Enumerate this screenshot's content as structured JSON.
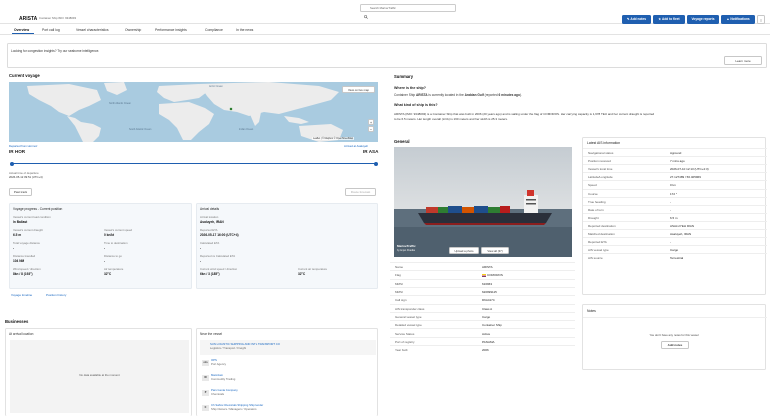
{
  "header": {
    "vessel_name": "ARISTA",
    "vessel_subtitle": "Container Ship IMO: 9348093",
    "search_placeholder": "Search MarineTraffic",
    "buttons": [
      "Add notes",
      "Add to fleet",
      "Voyage reports",
      "Notifications"
    ]
  },
  "tabs": [
    {
      "label": "Overview",
      "active": true
    },
    {
      "label": "Port call log"
    },
    {
      "label": "Vessel characteristics"
    },
    {
      "label": "Ownership"
    },
    {
      "label": "Performance insights"
    },
    {
      "label": "Compliance"
    },
    {
      "label": "In the news"
    }
  ],
  "banner": {
    "text": "Looking for congestion insights? Try our seaborne intelligence.",
    "button": "Learn more"
  },
  "current_voyage": {
    "title": "Current voyage",
    "map_button": "View on live map",
    "map_credit": "Leaflet | © Mapbox © OpenStreetMap",
    "map_labels": {
      "north_atlantic": "North Atlantic Ocean",
      "south_atlantic": "South Atlantic Ocean",
      "indian": "Indian Ocean",
      "arctic": "Arctic Ocean"
    },
    "departed_label": "Departed from Hormoz",
    "departure_port": "IR HOR",
    "arrival_label": "Arrived at Asaluyeh",
    "arrival_port": "IR ASA",
    "atd_label": "Actual time of departure",
    "atd_value": "2026-05-12 09:51 (UTC+4)",
    "past_track": "Past track",
    "route_forecast": "Route forecast",
    "progress_fraction": 1.0
  },
  "voyage_progress": {
    "title": "Voyage progress - Current position",
    "cells": [
      {
        "label": "Vessel's current load condition",
        "value": "In Ballast"
      },
      {
        "label": "",
        "value": ""
      },
      {
        "label": "Vessel's current draught",
        "value": "6.5 m"
      },
      {
        "label": "Vessel's current speed",
        "value": "0 kn/kt"
      },
      {
        "label": "Total voyage distance",
        "value": "-"
      },
      {
        "label": "Time to destination",
        "value": "-"
      },
      {
        "label": "Distance travelled",
        "value": "104 NM"
      },
      {
        "label": "Distance to go",
        "value": "-"
      },
      {
        "label": "Wind speed / direction",
        "value": "8kn / 8 (193°)"
      },
      {
        "label": "Air temperature",
        "value": "32°C"
      }
    ],
    "link1": "Voyage timeline",
    "link2": "Position history"
  },
  "arrival": {
    "title": "Arrival details",
    "cells": [
      {
        "label": "Arrival location",
        "value": "Asaluyeh, IRAN"
      },
      {
        "label": "Reported ETA",
        "value": "2026-05-17 16:00 (UTC+4)"
      },
      {
        "label": "Calculated ETA",
        "value": "-"
      },
      {
        "label": "Reported vs Calculated ETA",
        "value": "-"
      },
      {
        "label": "Current wind speed / direction",
        "value": "6kn / 3 (185°)"
      },
      {
        "label": "Current air temperature",
        "value": "32°C"
      }
    ]
  },
  "businesses": {
    "title": "Businesses",
    "arrival_location": "At arrival location",
    "no_data": "No data available at the moment",
    "near_vessel": "Near the vessel",
    "items": [
      {
        "name": "SUN LOGISTIC SHIPPING AND INTL TRANSPORT CO",
        "type": "Logistics / Transport / Freight",
        "logo": ""
      },
      {
        "name": "OPS",
        "type": "Port Agency",
        "logo": "OPS"
      },
      {
        "name": "Mamizam",
        "type": "Commodity Trading",
        "logo": "M"
      },
      {
        "name": "Pars Genia Company",
        "type": "Chemicals",
        "logo": "P"
      },
      {
        "name": "Ch Sahra Chemicals Shipping Ship lender",
        "type": "Ship Owners / Managers / Operators",
        "logo": "C"
      }
    ]
  },
  "summary": {
    "title": "Summary",
    "q1": "Where is the ship?",
    "a1_pre": "Container Ship ",
    "a1_name": "ARISTA",
    "a1_mid": " is currently located in the ",
    "a1_loc": "Arabian Gulf",
    "a1_post": " (reported ",
    "a1_time": "6 minutes ago",
    "a1_end": ").",
    "q2": "What kind of ship is this?",
    "a2_line1": "ARISTA (IMO: 9348093) is a Container Ship that was built in 2006 (20 years ago) and is sailing under the flag of COMOROS. Her carrying capacity is 1,678 TEU and her current draught is reported",
    "a2_line2": "to be 6.5 meters. Her length overall (LOA) is 160 meters and her width is 25.3 meters."
  },
  "general": {
    "title": "General",
    "photo_label": "MarineTraffic",
    "photo_credit": "by Anjan Khadka",
    "upload": "Upload a photo",
    "view_all": "View all (37)",
    "rows": [
      {
        "k": "Name",
        "v": "ARISTA"
      },
      {
        "k": "Flag",
        "v": "COMOROS"
      },
      {
        "k": "MMSI",
        "v": "616963"
      },
      {
        "k": "MMSI",
        "v": "620999115"
      },
      {
        "k": "Call sign",
        "v": "D6A4174"
      },
      {
        "k": "AIS transponder class",
        "v": "Class A"
      },
      {
        "k": "General vessel type",
        "v": "Cargo"
      },
      {
        "k": "Detailed vessel type",
        "v": "Container Ship"
      },
      {
        "k": "Service Status",
        "v": "Active"
      },
      {
        "k": "Port of registry",
        "v": "PANAMA"
      },
      {
        "k": "Year built",
        "v": "2006"
      }
    ]
  },
  "ais": {
    "title": "Latest AIS information",
    "rows": [
      {
        "k": "Navigational status",
        "v": "Aground",
        "link": false
      },
      {
        "k": "Position received",
        "v": "7 mins ago",
        "link": false
      },
      {
        "k": "Vessel's local time",
        "v": "2026-07-10 12:13 (UTC+4:3)",
        "link": false
      },
      {
        "k": "Latitude/Longitude",
        "v": "27.127489 / 56.405969",
        "link": true
      },
      {
        "k": "Speed",
        "v": "0 kn",
        "link": false
      },
      {
        "k": "Course",
        "v": "172 °",
        "link": false
      },
      {
        "k": "True heading",
        "v": "-",
        "link": false
      },
      {
        "k": "Rate of turn",
        "v": "-",
        "link": false
      },
      {
        "k": "Draught",
        "v": "6.5 m",
        "link": false
      },
      {
        "k": "Reported destination",
        "v": "ASALUYEH IRAN",
        "link": false
      },
      {
        "k": "Matched destination",
        "v": "Asaluyeh, IRAN",
        "link": false
      },
      {
        "k": "Reported ETA",
        "v": "-",
        "link": false
      },
      {
        "k": "AIS vessel type",
        "v": "Cargo",
        "link": false
      },
      {
        "k": "AIS source",
        "v": "Terrestrial",
        "link": false
      }
    ]
  },
  "notes": {
    "title": "Notes",
    "empty": "You don't have any notes for this vessel",
    "button": "Add notes"
  },
  "colors": {
    "accent": "#1f5fb0",
    "map_water": "#a9cbe0",
    "map_land": "#ececec"
  }
}
